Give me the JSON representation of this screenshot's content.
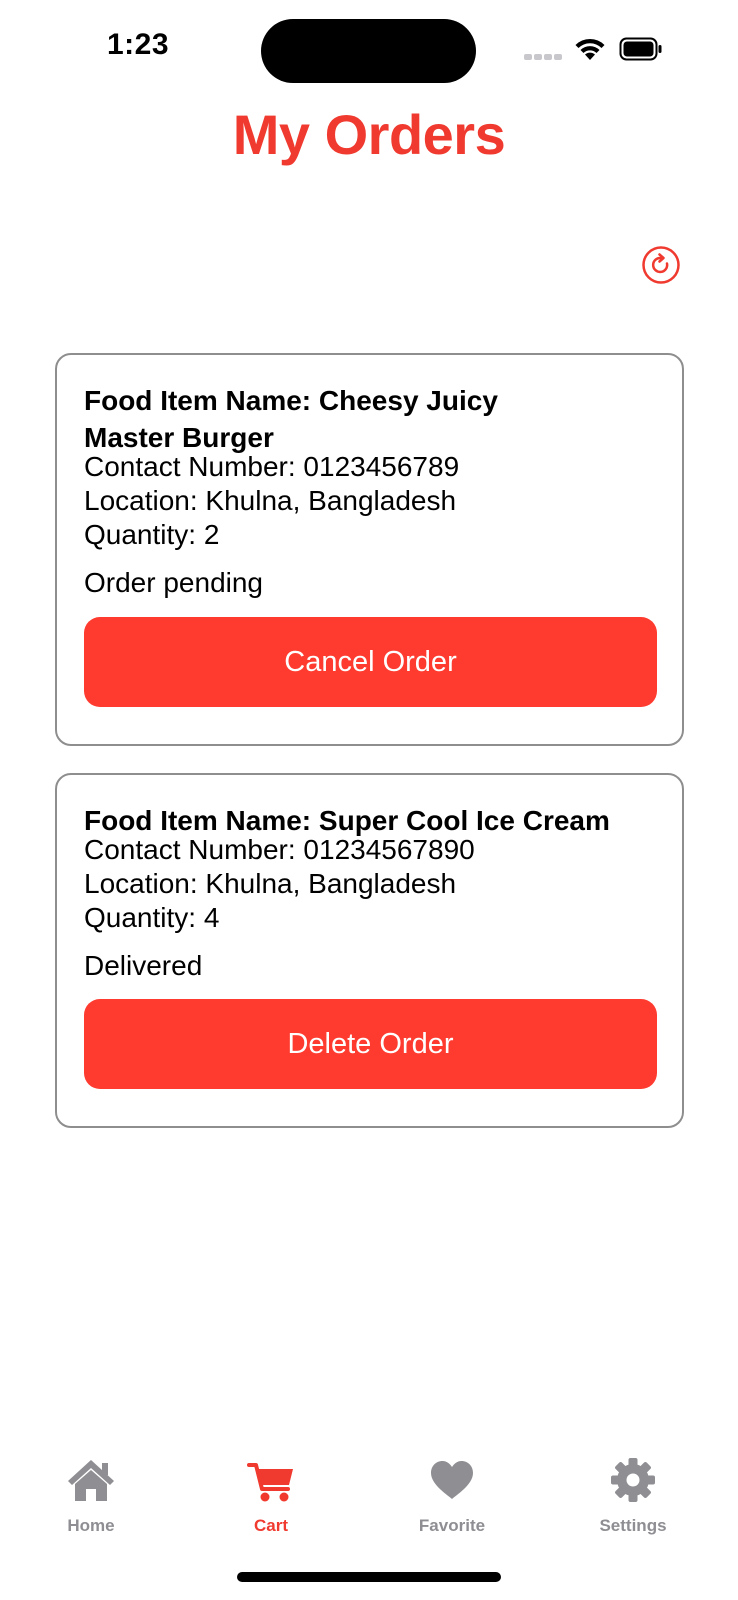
{
  "status_bar": {
    "time": "1:23"
  },
  "header": {
    "title": "My Orders"
  },
  "orders": [
    {
      "food_name": "Food Item Name: Cheesy Juicy Master Burger",
      "contact": "Contact Number: 0123456789",
      "location": "Location: Khulna, Bangladesh",
      "quantity": "Quantity: 2",
      "status": "Order pending",
      "action_label": "Cancel Order"
    },
    {
      "food_name": "Food Item Name: Super Cool Ice Cream",
      "contact": "Contact Number: 01234567890",
      "location": "Location: Khulna, Bangladesh",
      "quantity": "Quantity: 4",
      "status": "Delivered",
      "action_label": "Delete Order"
    }
  ],
  "tab_bar": {
    "active": "Cart",
    "active_color": "#f03a2f",
    "inactive_color": "#8e8e93",
    "tabs": [
      {
        "label": "Home",
        "icon": "house-icon"
      },
      {
        "label": "Cart",
        "icon": "cart-icon"
      },
      {
        "label": "Favorite",
        "icon": "heart-icon"
      },
      {
        "label": "Settings",
        "icon": "gear-icon"
      }
    ]
  },
  "colors": {
    "accent": "#f03a2f",
    "button": "#ff3b30",
    "card_border": "#8e8e8e"
  }
}
